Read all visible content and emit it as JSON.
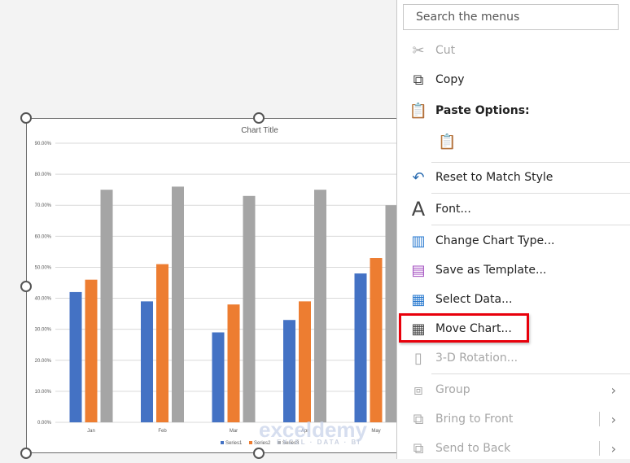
{
  "chart_data": {
    "type": "bar",
    "title": "Chart Title",
    "categories": [
      "Jan",
      "Feb",
      "Mar",
      "Apr",
      "May"
    ],
    "series": [
      {
        "name": "Series1",
        "color": "#4472c4",
        "values": [
          42,
          39,
          29,
          33,
          48
        ]
      },
      {
        "name": "Series2",
        "color": "#ed7d31",
        "values": [
          46,
          51,
          38,
          39,
          53
        ]
      },
      {
        "name": "Series3",
        "color": "#a5a5a5",
        "values": [
          75,
          76,
          73,
          75,
          70
        ]
      }
    ],
    "yticks": [
      "0.00%",
      "10.00%",
      "20.00%",
      "30.00%",
      "40.00%",
      "50.00%",
      "60.00%",
      "70.00%",
      "80.00%",
      "90.00%"
    ],
    "ylim": [
      0,
      90
    ],
    "grid": true,
    "legend": "bottom"
  },
  "watermark": {
    "name": "exceldemy",
    "tagline": "EXCEL · DATA · BI"
  },
  "menu": {
    "search_placeholder": "Search the menus",
    "items": [
      {
        "label": "Cut",
        "icon": "scissors-icon",
        "disabled": true
      },
      {
        "label": "Copy",
        "icon": "copy-icon"
      },
      {
        "label": "Paste Options:",
        "icon": "paste-icon"
      },
      {
        "label": "Reset to Match Style",
        "icon": "reset-style-icon"
      },
      {
        "label": "Font...",
        "icon": "font-icon"
      },
      {
        "label": "Change Chart Type...",
        "icon": "chart-type-icon"
      },
      {
        "label": "Save as Template...",
        "icon": "save-template-icon"
      },
      {
        "label": "Select Data...",
        "icon": "select-data-icon"
      },
      {
        "label": "Move Chart...",
        "icon": "move-chart-icon"
      },
      {
        "label": "3-D Rotation...",
        "icon": "rotation-3d-icon",
        "disabled": true
      },
      {
        "label": "Group",
        "icon": "group-icon",
        "disabled": true
      },
      {
        "label": "Bring to Front",
        "icon": "bring-front-icon",
        "disabled": true
      },
      {
        "label": "Send to Back",
        "icon": "send-back-icon",
        "disabled": true
      }
    ],
    "highlight_color": "#e8000b"
  }
}
